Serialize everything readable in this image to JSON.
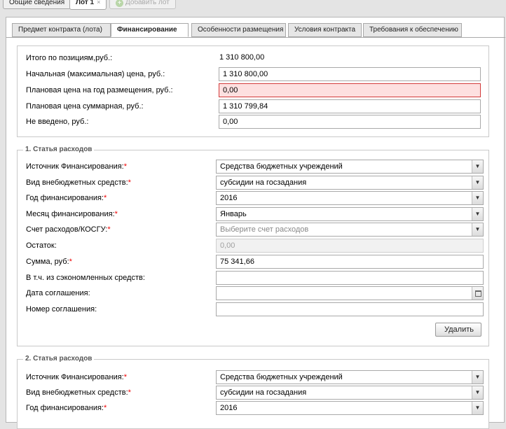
{
  "top_tabs": {
    "general": "Общие сведения",
    "lot": "Лот 1",
    "lot_close": "×",
    "add_lot": "Добавить лот",
    "add_symbol": "+"
  },
  "sub_tabs": [
    "Предмет контракта (лота)",
    "Финансирование",
    "Особенности размещения",
    "Условия контракта",
    "Требования к обеспечению"
  ],
  "totals": {
    "total_label": "Итого по позициям,руб.:",
    "total_value": "1 310 800,00",
    "initial_label": "Начальная (максимальная) цена, руб.:",
    "initial_value": "1 310 800,00",
    "planned_year_label": "Плановая цена на год размещения, руб.:",
    "planned_year_value": "0,00",
    "planned_sum_label": "Плановая цена суммарная, руб.:",
    "planned_sum_value": "1 310 799,84",
    "not_entered_label": "Не введено, руб.:",
    "not_entered_value": "0,00"
  },
  "expense1": {
    "title": "1. Статья расходов",
    "source_label": "Источник Финансирования:",
    "source_value": "Средства бюджетных учреждений",
    "offbudget_label": "Вид внебюджетных средств:",
    "offbudget_value": "субсидии на госзадания",
    "year_label": "Год финансирования:",
    "year_value": "2016",
    "month_label": "Месяц финансирования:",
    "month_value": "Январь",
    "account_label": "Счет расходов/КОСГУ:",
    "account_placeholder": "Выберите счет расходов",
    "balance_label": "Остаток:",
    "balance_value": "0,00",
    "sum_label": "Сумма, руб:",
    "sum_value": "75 341,66",
    "savings_label": "В т.ч. из сэкономленных средств:",
    "savings_value": "",
    "agreement_date_label": "Дата соглашения:",
    "agreement_date_value": "",
    "agreement_number_label": "Номер соглашения:",
    "agreement_number_value": "",
    "delete_button": "Удалить"
  },
  "expense2": {
    "title": "2. Статья расходов",
    "source_label": "Источник Финансирования:",
    "source_value": "Средства бюджетных учреждений",
    "offbudget_label": "Вид внебюджетных средств:",
    "offbudget_value": "субсидии на госзадания",
    "year_label": "Год финансирования:",
    "year_value": "2016"
  },
  "required_mark": "*",
  "icons": {
    "dropdown": "chevron-down-icon",
    "calendar": "calendar-icon",
    "add": "plus-icon"
  },
  "colors": {
    "required": "#e00000",
    "error_border": "#d23b3b",
    "error_fill": "#fde0e0"
  }
}
